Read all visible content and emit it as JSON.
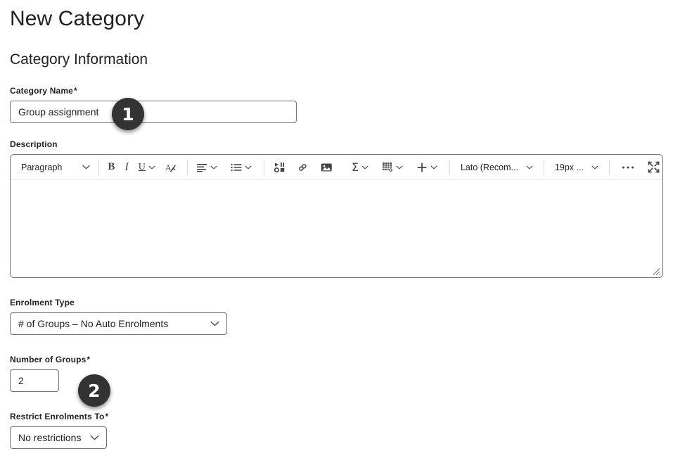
{
  "page": {
    "title": "New Category",
    "section_title": "Category Information"
  },
  "fields": {
    "category_name": {
      "label": "Category Name",
      "required_mark": "*",
      "value": "Group assignment",
      "placeholder": "Group assignment"
    },
    "description": {
      "label": "Description",
      "value": "",
      "placeholder": ""
    },
    "enrolment_type": {
      "label": "Enrolment Type",
      "value": "# of Groups – No Auto Enrolments"
    },
    "number_of_groups": {
      "label": "Number of Groups",
      "required_mark": "*",
      "value": "2"
    },
    "restrict_enrolments": {
      "label": "Restrict Enrolments To",
      "required_mark": "*",
      "value": "No restrictions"
    }
  },
  "editor_toolbar": {
    "paragraph_style": "Paragraph",
    "font_family": "Lato (Recom...",
    "font_size": "19px ...",
    "items": [
      {
        "name": "paragraph-style-dropdown",
        "label": "Paragraph",
        "icon": "chevron-down-icon"
      },
      {
        "name": "bold-button",
        "label": "B",
        "icon": "bold-icon"
      },
      {
        "name": "italic-button",
        "label": "I",
        "icon": "italic-icon"
      },
      {
        "name": "underline-button",
        "label": "U",
        "icon": "underline-icon"
      },
      {
        "name": "clear-formatting-button",
        "label": "A",
        "icon": "clear-formatting-icon"
      },
      {
        "name": "align-dropdown",
        "label": "",
        "icon": "align-left-icon"
      },
      {
        "name": "list-dropdown",
        "label": "",
        "icon": "bulleted-list-icon"
      },
      {
        "name": "insert-stuff-button",
        "label": "",
        "icon": "insert-stuff-icon"
      },
      {
        "name": "insert-link-button",
        "label": "",
        "icon": "link-icon"
      },
      {
        "name": "insert-image-button",
        "label": "",
        "icon": "image-icon"
      },
      {
        "name": "equation-dropdown",
        "label": "",
        "icon": "sigma-icon"
      },
      {
        "name": "table-dropdown",
        "label": "",
        "icon": "table-icon"
      },
      {
        "name": "insert-more-dropdown",
        "label": "",
        "icon": "plus-icon"
      },
      {
        "name": "more-options-button",
        "label": "",
        "icon": "ellipsis-icon"
      },
      {
        "name": "fullscreen-button",
        "label": "",
        "icon": "fullscreen-icon"
      }
    ]
  },
  "callouts": [
    {
      "number": "1"
    },
    {
      "number": "2"
    }
  ],
  "colors": {
    "text": "#202122",
    "border": "#6e7477",
    "badge_bg": "#333333",
    "toolbar_divider": "#e6e7e8"
  }
}
